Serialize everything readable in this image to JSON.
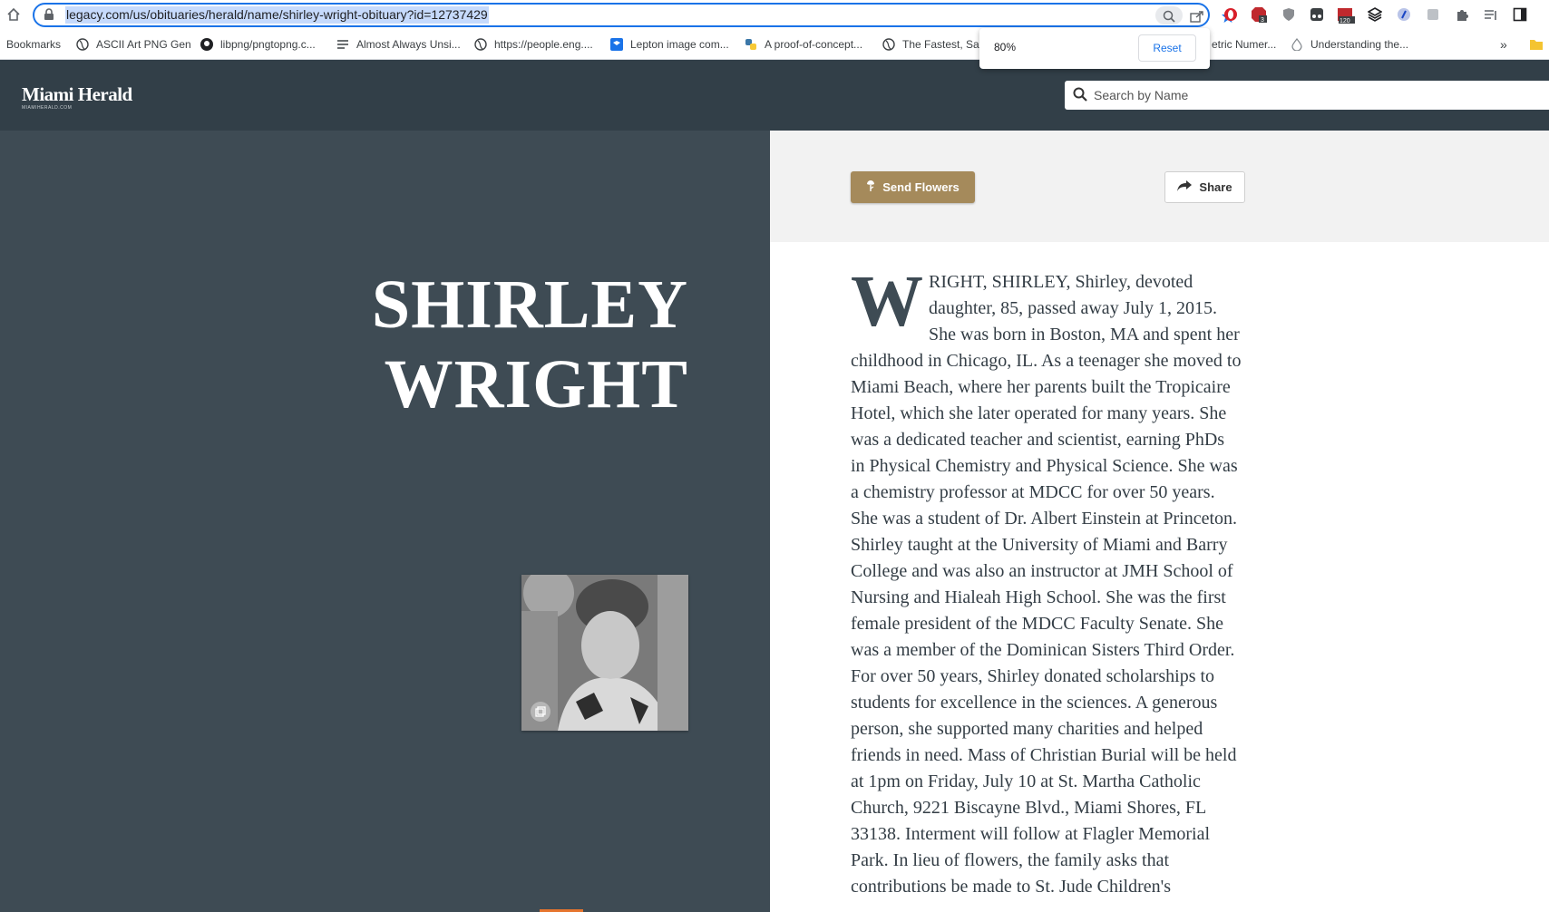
{
  "browser": {
    "url": "legacy.com/us/obituaries/herald/name/shirley-wright-obituary?id=12737429",
    "zoom_popup": {
      "value": "80%",
      "minus": "−",
      "plus": "+",
      "reset": "Reset"
    },
    "bookmarks": [
      {
        "label": "Bookmarks",
        "icon": "none"
      },
      {
        "label": "ASCII Art PNG Gen",
        "icon": "globe-icon"
      },
      {
        "label": "libpng/pngtopng.c...",
        "icon": "github-icon"
      },
      {
        "label": "Almost Always Unsi...",
        "icon": "lines-icon"
      },
      {
        "label": "https://people.eng....",
        "icon": "globe-icon"
      },
      {
        "label": "Lepton image com...",
        "icon": "dropbox-icon"
      },
      {
        "label": "A proof-of-concept...",
        "icon": "python-icon"
      },
      {
        "label": "The Fastest, Safe",
        "icon": "globe-icon"
      },
      {
        "label": "etric Numer...",
        "icon": "none"
      },
      {
        "label": "Understanding the...",
        "icon": "drop-icon"
      }
    ],
    "extension_badges": {
      "abp": "3",
      "calendar": "120"
    }
  },
  "site": {
    "logo": "Miami Herald",
    "logo_sub": "MIAMIHERALD.COM",
    "search_placeholder": "Search by Name"
  },
  "obituary": {
    "name_line1": "SHIRLEY",
    "name_line2": "WRIGHT",
    "send_flowers": "Send Flowers",
    "share": "Share",
    "dropcap": "W",
    "text": "RIGHT, SHIRLEY, Shirley, devoted daughter, 85, passed away July 1, 2015. She was born in Boston, MA and spent her childhood in Chicago, IL. As a teenager she moved to Miami Beach, where her parents built the Tropicaire Hotel, which she later operated for many years. She was a dedicated teacher and scientist, earning PhDs in Physical Chemistry and Physical Science. She was a chemistry professor at MDCC for over 50 years. She was a student of Dr. Albert Einstein at Princeton. Shirley taught at the University of Miami and Barry College and was also an instructor at JMH School of Nursing and Hialeah High School. She was the first female president of the MDCC Faculty Senate. She was a member of the Dominican Sisters Third Order. For over 50 years, Shirley donated scholarships to students for excellence in the sciences. A generous person, she supported many charities and helped friends in need. Mass of Christian Burial will be held at 1pm on Friday, July 10 at St. Martha Catholic Church, 9221 Biscayne Blvd., Miami Shores, FL 33138. Interment will follow at Flagler Memorial Park. In lieu of flowers, the family asks that contributions be made to St. Jude Children's"
  },
  "colors": {
    "header": "#323f48",
    "left_panel": "#3e4b54",
    "send_flowers": "#a58a5b",
    "url_highlight": "#c6dafc"
  }
}
